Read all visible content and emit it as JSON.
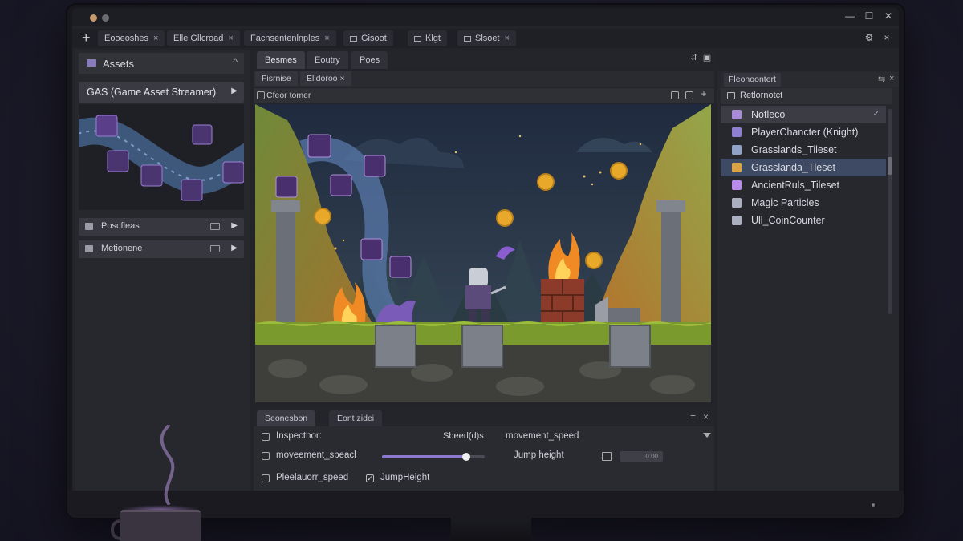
{
  "window": {
    "close": "✕",
    "minimize": "—",
    "maximize": "☐"
  },
  "tabs": [
    {
      "label": "Eooeoshes",
      "close": "×"
    },
    {
      "label": "Elle Gllcroad",
      "close": "×"
    },
    {
      "label": "Facnsentenlnples",
      "close": "×"
    },
    {
      "label": "Gisoot",
      "close": ""
    },
    {
      "label": "Klgt",
      "close": ""
    },
    {
      "label": "Slsoet",
      "close": "×"
    }
  ],
  "tab_add": "+",
  "left_panel": {
    "title": "Assets",
    "collapse": "^",
    "gas_label": "GAS (Game Asset Streamer)",
    "gas_arrow": "▶",
    "collections": [
      {
        "label": "Poscfleas",
        "arrow": "▶"
      },
      {
        "label": "Metionene",
        "arrow": "▶"
      }
    ]
  },
  "view_tabs": [
    "Besmes",
    "Eoutry",
    "Poes"
  ],
  "sub_tabs": [
    {
      "label": "Fisrnise",
      "close": ""
    },
    {
      "label": "Elidoroo",
      "close": "×"
    }
  ],
  "viewport": {
    "label": "Cfeor tomer"
  },
  "right_panel": {
    "tab": "Fleonoontert",
    "controls": [
      "⇆",
      "×"
    ],
    "subheader": "Retlornotct",
    "items": [
      {
        "label": "Notleco",
        "color": "#a78bd6",
        "state": "highlight",
        "check": "✓"
      },
      {
        "label": "PlayerChancter (Knight)",
        "color": "#8f7fd1",
        "state": "",
        "check": ""
      },
      {
        "label": "Grasslands_Tileset",
        "color": "#8ea3c7",
        "state": "",
        "check": ""
      },
      {
        "label": "Grasslanda_Tleset",
        "color": "#d9a441",
        "state": "selected",
        "check": ""
      },
      {
        "label": "AncientRuls_Tileset",
        "color": "#b88ce8",
        "state": "",
        "check": ""
      },
      {
        "label": "Magic Particles",
        "color": "#aab0bf",
        "state": "",
        "check": ""
      },
      {
        "label": "Ull_CoinCounter",
        "color": "#aab0bf",
        "state": "",
        "check": ""
      }
    ]
  },
  "inspector": {
    "tabs": [
      "Seonesbon",
      "Eont zidei"
    ],
    "controls": [
      "=",
      "×"
    ],
    "row1_label": "Inspecthor:",
    "row1_field": "Sbeerl(d)s",
    "row1_value": "movement_speed",
    "row2_label": "moveement_speacl",
    "slider_value": 0.82,
    "row2_jump": "Jump height",
    "row2_field_value": "0.00",
    "row3_label": "Pleelauorr_speed",
    "row3_check": "✓",
    "row3_value": "JumpHeight"
  },
  "colors": {
    "accent": "#8b7ad0",
    "selection": "#3e4a63",
    "coin": "#e8a92b",
    "fire": "#f08a24"
  }
}
